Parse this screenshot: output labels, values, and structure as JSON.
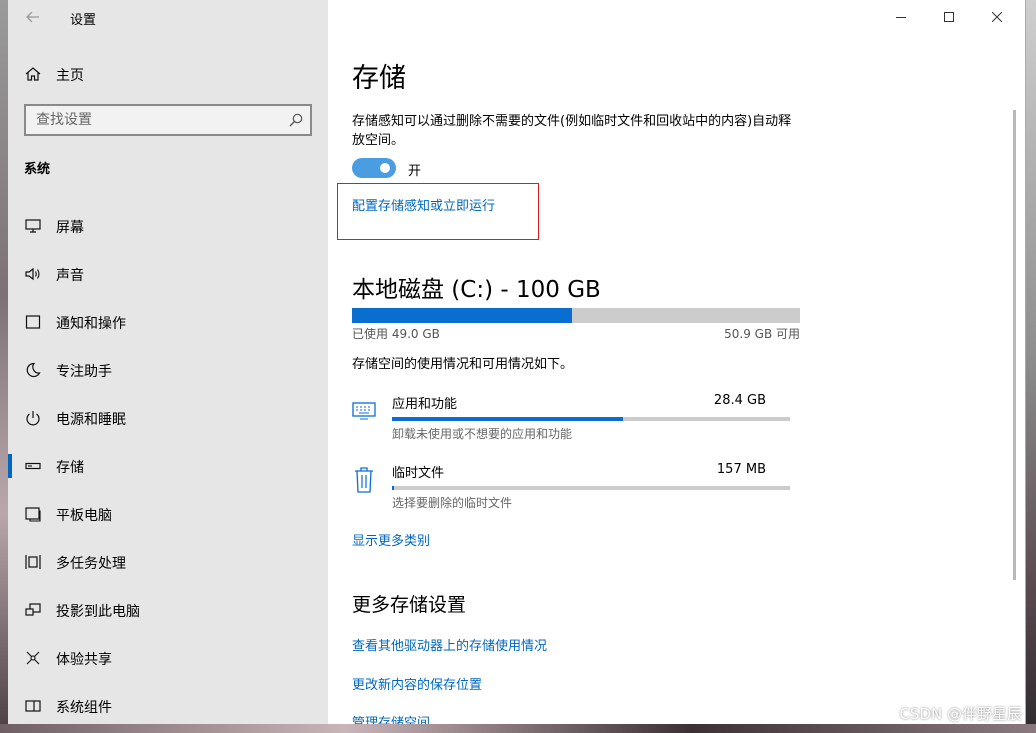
{
  "app": {
    "title": "设置"
  },
  "sidebar": {
    "home_label": "主页",
    "search_placeholder": "查找设置",
    "section_title": "系统",
    "items": [
      {
        "label": "屏幕",
        "icon": "monitor-icon"
      },
      {
        "label": "声音",
        "icon": "speaker-icon"
      },
      {
        "label": "通知和操作",
        "icon": "notification-icon"
      },
      {
        "label": "专注助手",
        "icon": "moon-icon"
      },
      {
        "label": "电源和睡眠",
        "icon": "power-icon"
      },
      {
        "label": "存储",
        "icon": "storage-icon",
        "active": true
      },
      {
        "label": "平板电脑",
        "icon": "tablet-icon"
      },
      {
        "label": "多任务处理",
        "icon": "multitask-icon"
      },
      {
        "label": "投影到此电脑",
        "icon": "project-icon"
      },
      {
        "label": "体验共享",
        "icon": "share-icon"
      },
      {
        "label": "系统组件",
        "icon": "components-icon"
      }
    ]
  },
  "main": {
    "title": "存储",
    "description": "存储感知可以通过删除不需要的文件(例如临时文件和回收站中的内容)自动释放空间。",
    "toggle": {
      "state": "on",
      "label": "开"
    },
    "config_link": "配置存储感知或立即运行",
    "disk": {
      "title": "本地磁盘 (C:) - 100 GB",
      "used_label": "已使用 49.0 GB",
      "free_label": "50.9 GB 可用",
      "used_fraction": 0.49
    },
    "usage_description": "存储空间的使用情况和可用情况如下。",
    "categories": [
      {
        "name": "应用和功能",
        "size": "28.4 GB",
        "subtitle": "卸载未使用或不想要的应用和功能",
        "fraction": 0.58,
        "icon": "keyboard-icon"
      },
      {
        "name": "临时文件",
        "size": "157 MB",
        "subtitle": "选择要删除的临时文件",
        "fraction": 0.003,
        "icon": "trash-icon"
      }
    ],
    "more_categories_link": "显示更多类别",
    "more_settings_title": "更多存储设置",
    "links": {
      "other_drives": "查看其他驱动器上的存储使用情况",
      "save_location": "更改新内容的保存位置",
      "manage_spaces": "管理存储空间"
    }
  },
  "colors": {
    "accent": "#0a6ed1",
    "link": "#0067c0",
    "highlight_box": "#e0191f",
    "toggle_on": "#4a9de0"
  },
  "watermark": "CSDN @伴野星辰"
}
